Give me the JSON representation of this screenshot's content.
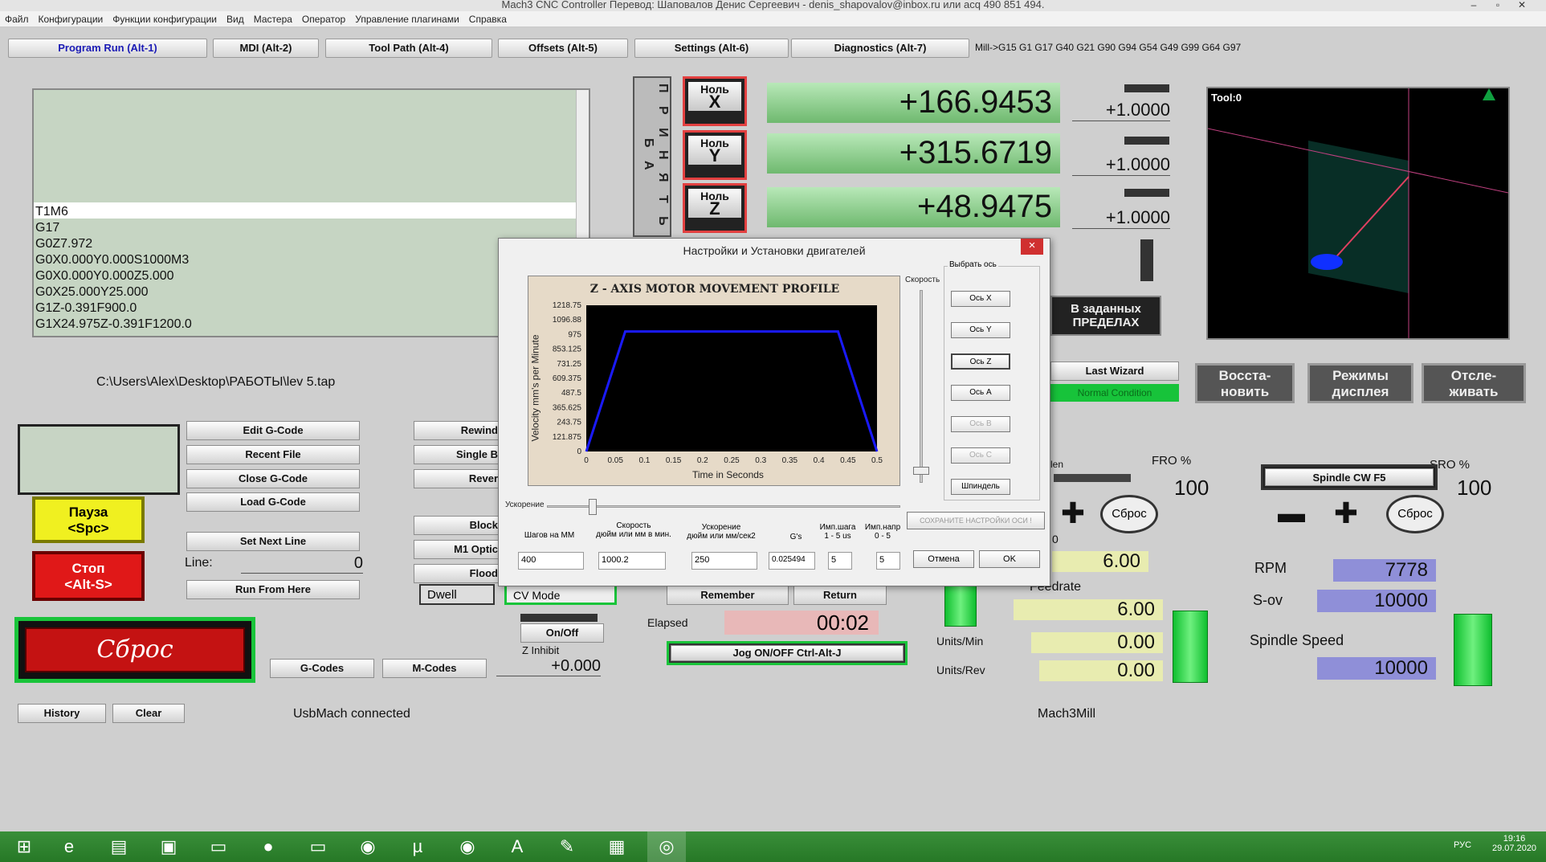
{
  "window": {
    "title": "Mach3 CNC Controller Перевод: Шаповалов Денис Сергеевич - denis_shapovalov@inbox.ru или acq 490 851 494."
  },
  "menu": [
    "Файл",
    "Конфигурации",
    "Функции конфигурации",
    "Вид",
    "Мастера",
    "Оператор",
    "Управление плагинами",
    "Справка"
  ],
  "tabs": [
    "Program Run (Alt-1)",
    "MDI (Alt-2)",
    "Tool Path (Alt-4)",
    "Offsets (Alt-5)",
    "Settings (Alt-6)",
    "Diagnostics (Alt-7)"
  ],
  "modal_line": "Mill->G15  G1 G17 G40 G21 G90 G94 G54 G49 G99 G64 G97",
  "gcode_lines": [
    "T1M6",
    "G17",
    "G0Z7.972",
    "G0X0.000Y0.000S1000M3",
    "G0X0.000Y0.000Z5.000",
    "G0X25.000Y25.000",
    "G1Z-0.391F900.0",
    "G1X24.975Z-0.391F1200.0"
  ],
  "file_path": "C:\\Users\\Alex\\Desktop\\РАБОТЫ\\lev 5.tap",
  "vertical_label": "П Р И Н Я Т Ь  Б А",
  "zero_buttons": [
    {
      "top": "Ноль",
      "axis": "X"
    },
    {
      "top": "Ноль",
      "axis": "Y"
    },
    {
      "top": "Ноль",
      "axis": "Z"
    }
  ],
  "dro": {
    "x": "+166.9453",
    "y": "+315.6719",
    "z": "+48.9475",
    "scale_x": "+1.0000",
    "scale_y": "+1.0000",
    "scale_z": "+1.0000"
  },
  "toolpath": {
    "label": "Tool:0"
  },
  "buttons": {
    "edit": "Edit G-Code",
    "recent": "Recent File",
    "close": "Close G-Code",
    "load": "Load G-Code",
    "set_next": "Set Next Line",
    "run_from": "Run From Here",
    "rewind": "Rewind",
    "single": "Single B",
    "reverse": "Rever",
    "block": "Block",
    "m1": "M1 Optic",
    "flood": "Flood",
    "dwell": "Dwell",
    "cv": "CV Mode",
    "pause": "Пауза\n<Spc>",
    "stop": "Стоп\n<Alt-S>",
    "reset": "Сброс",
    "gcodes": "G-Codes",
    "mcodes": "M-Codes",
    "history": "History",
    "clear": "Clear",
    "onoff": "On/Off",
    "remember": "Remember",
    "return": "Return",
    "jog": "Jog ON/OFF Ctrl-Alt-J",
    "last_wizard": "Last Wizard",
    "normal": "Normal Condition",
    "limits": "В заданных\nПРЕДЕЛАХ",
    "restore": "Восста-\nновить",
    "display": "Режимы\nдисплея",
    "track": "Отсле-\nживать",
    "spindle_cw": "Spindle CW F5",
    "fro_reset": "Сброс",
    "sro_reset": "Сброс"
  },
  "line": {
    "label": "Line:",
    "value": "0"
  },
  "zinhibit": {
    "label": "Z Inhibit",
    "value": "+0.000"
  },
  "elapsed": {
    "label": "Elapsed",
    "value": "00:02"
  },
  "status": {
    "usb": "UsbMach connected",
    "profile": "Mach3Mill"
  },
  "feed": {
    "fro_label": "FRO %",
    "fro": "100",
    "feed_label": "Feedrate",
    "fro_val": "6.00",
    "feedrate": "6.00",
    "units_min_label": "Units/Min",
    "units_min": "0.00",
    "units_rev_label": "Units/Rev",
    "units_rev": "0.00",
    "len_label": "len",
    "zero_mark": "0"
  },
  "spindle": {
    "sro_label": "SRO %",
    "sro": "100",
    "rpm_label": "RPM",
    "rpm": "7778",
    "sov_label": "S-ov",
    "sov": "10000",
    "speed_label": "Spindle Speed",
    "speed": "10000"
  },
  "dialog": {
    "title": "Настройки и Установки двигателей",
    "close": "×",
    "speed_label": "Скорость",
    "accel_label": "Ускорение",
    "axis_group": "Выбрать ось",
    "axes": [
      "Ось X",
      "Ось Y",
      "Ось Z",
      "Ось A",
      "Ось B",
      "Ось C",
      "Шпиндель"
    ],
    "save": "СОХРАНИТЕ НАСТРОЙКИ ОСИ !",
    "cancel": "Отмена",
    "ok": "OK",
    "fields": [
      {
        "label": "Шагов на ММ",
        "value": "400"
      },
      {
        "label": "Скорость\nдюйм или мм в мин.",
        "value": "1000.2"
      },
      {
        "label": "Ускорение\nдюйм или мм/сек2",
        "value": "250"
      },
      {
        "label": "G's",
        "value": "0.025494"
      },
      {
        "label": "Имп.шага\n1 - 5 us",
        "value": "5"
      },
      {
        "label": "Имп.напр\n0 - 5",
        "value": "5"
      }
    ]
  },
  "chart_data": {
    "type": "line",
    "title": "Z - AXIS MOTOR MOVEMENT PROFILE",
    "xlabel": "Time in Seconds",
    "ylabel": "Velocity mm's per Minute",
    "x_ticks": [
      "0",
      "0.05",
      "0.1",
      "0.15",
      "0.2",
      "0.25",
      "0.3",
      "0.35",
      "0.4",
      "0.45",
      "0.5"
    ],
    "y_ticks": [
      "0",
      "121.875",
      "243.75",
      "365.625",
      "487.5",
      "609.375",
      "731.25",
      "853.125",
      "975",
      "1096.88",
      "1218.75"
    ],
    "xlim": [
      0,
      0.5
    ],
    "ylim": [
      0,
      1218.75
    ],
    "series": [
      {
        "x": [
          0,
          0.067,
          0.433,
          0.5
        ],
        "y": [
          0,
          1000.2,
          1000.2,
          0
        ]
      }
    ],
    "colors": {
      "line": "#1a1aff",
      "bg": "#000000"
    }
  },
  "taskbar": {
    "lang": "РУС",
    "time": "19:16",
    "date": "29.07.2020"
  }
}
